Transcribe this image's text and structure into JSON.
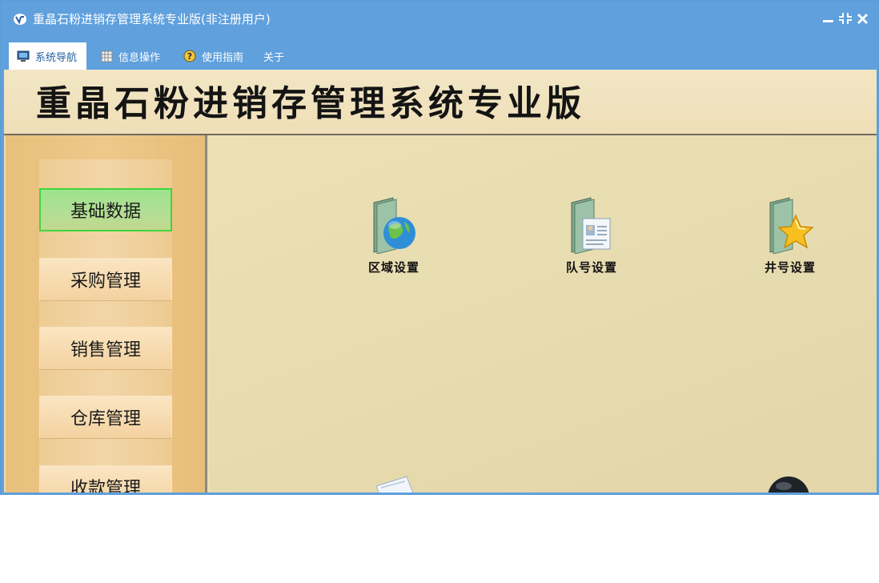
{
  "window": {
    "title": "重晶石粉进销存管理系统专业版(非注册用户)"
  },
  "menu": {
    "items": [
      {
        "label": "系统导航",
        "icon": "monitor-icon",
        "active": true
      },
      {
        "label": "信息操作",
        "icon": "grid-icon",
        "active": false
      },
      {
        "label": "使用指南",
        "icon": "help-icon",
        "active": false
      },
      {
        "label": "关于",
        "icon": "",
        "active": false
      }
    ]
  },
  "banner": {
    "title": "重晶石粉进销存管理系统专业版"
  },
  "sidebar": {
    "items": [
      {
        "label": "基础数据",
        "active": true
      },
      {
        "label": "采购管理",
        "active": false
      },
      {
        "label": "销售管理",
        "active": false
      },
      {
        "label": "仓库管理",
        "active": false
      },
      {
        "label": "收款管理",
        "active": false
      }
    ]
  },
  "main": {
    "tiles": [
      {
        "label": "区域设置",
        "icon": "globe-folder-icon"
      },
      {
        "label": "队号设置",
        "icon": "contact-card-folder-icon"
      },
      {
        "label": "井号设置",
        "icon": "star-folder-icon"
      }
    ],
    "partial_icons": [
      "document-icon",
      "round-dark-icon"
    ]
  },
  "colors": {
    "titlebar": "#5fa0dd",
    "active_nav": "#9de38f",
    "sidebar": "#e8c07c",
    "main_bg": "#e9ddb6"
  }
}
